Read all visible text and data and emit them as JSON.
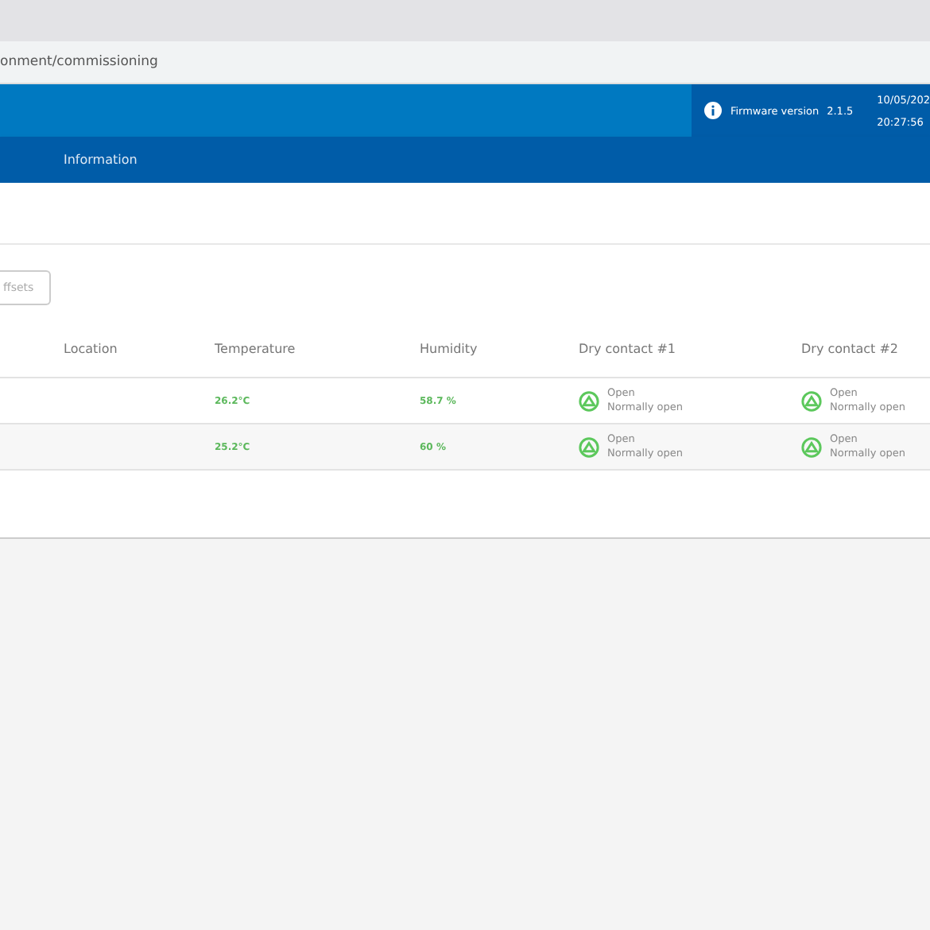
{
  "address_bar": {
    "url": "onment/commissioning"
  },
  "header": {
    "firmware_label": "Firmware version",
    "firmware_version": "2.1.5",
    "date": "10/05/202",
    "time": "20:27:56"
  },
  "nav": {
    "items": [
      {
        "label": "Information",
        "selected": false
      }
    ]
  },
  "offsets_button": {
    "label": "ffsets"
  },
  "table": {
    "columns": [
      "Location",
      "Temperature",
      "Humidity",
      "Dry contact #1",
      "Dry contact #2"
    ],
    "rows": [
      {
        "temperature": "26.2°C",
        "humidity": "58.7 %",
        "contacts": [
          {
            "state": "Open",
            "mode": "Normally open"
          },
          {
            "state": "Open",
            "mode": "Normally open"
          }
        ]
      },
      {
        "temperature": "25.2°C",
        "humidity": "60 %",
        "contacts": [
          {
            "state": "Open",
            "mode": "Normally open"
          },
          {
            "state": "Open",
            "mode": "Normally open"
          }
        ]
      }
    ]
  }
}
